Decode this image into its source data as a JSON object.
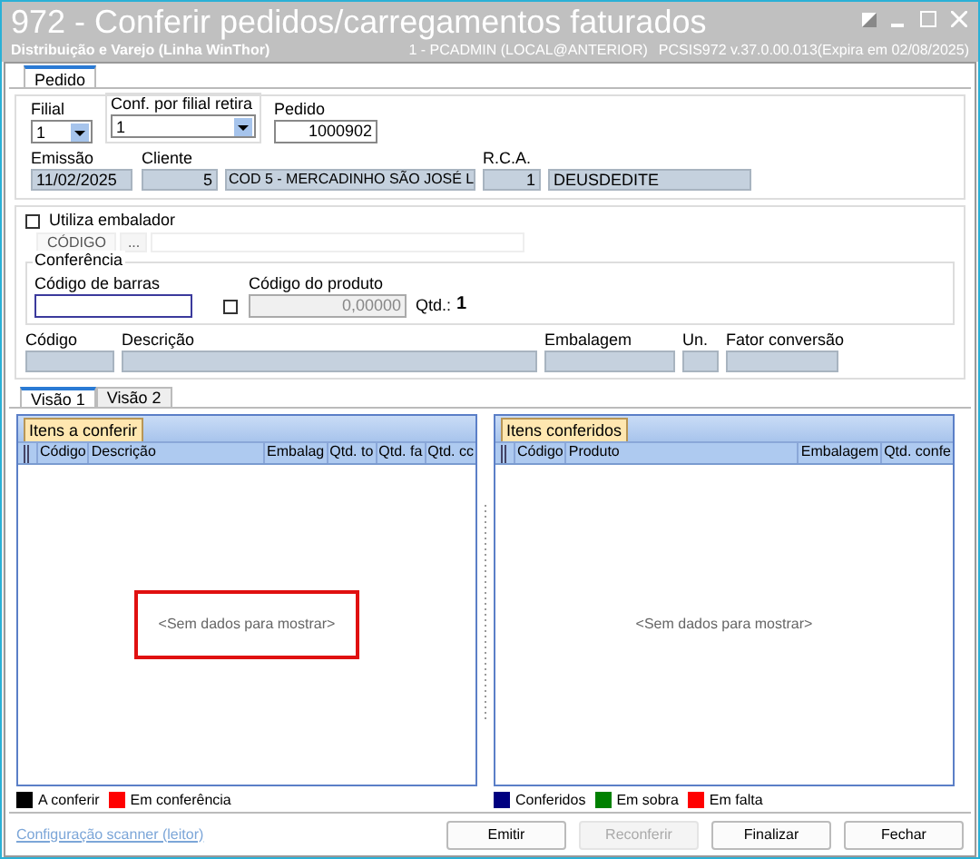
{
  "window": {
    "title": "972 - Conferir pedidos/carregamentos faturados",
    "subtitle": "Distribuição e Varejo (Linha WinThor)",
    "user_info": "1 - PCADMIN (LOCAL@ANTERIOR)",
    "version_info": "PCSIS972  v.37.0.00.013(Expira em 02/08/2025)"
  },
  "tabs": [
    {
      "label": "Pedido",
      "selected": true
    }
  ],
  "header": {
    "filial": {
      "label": "Filial",
      "value": "1"
    },
    "conf_filial": {
      "label": "Conf. por filial retira",
      "value": "1"
    },
    "pedido": {
      "label": "Pedido",
      "value": "1000902"
    },
    "emissao": {
      "label": "Emissão",
      "value": "11/02/2025"
    },
    "cliente": {
      "label": "Cliente",
      "code": "5",
      "name": "COD 5 - MERCADINHO SÃO JOSÉ L"
    },
    "rca": {
      "label": "R.C.A.",
      "code": "1",
      "name": "DEUSDEDITE"
    }
  },
  "embalador": {
    "label": "Utiliza embalador",
    "checked": false,
    "code_label": "CÓDIGO",
    "browse": "..."
  },
  "conferencia": {
    "title": "Conferência",
    "barcode_label": "Código de barras",
    "product_label": "Código do produto",
    "product_checked": false,
    "product_value": "0,00000",
    "qty_label": "Qtd.:",
    "qty_value": "1"
  },
  "product_fields": [
    {
      "label": "Código"
    },
    {
      "label": "Descrição"
    },
    {
      "label": "Embalagem"
    },
    {
      "label": "Un."
    },
    {
      "label": "Fator conversão"
    }
  ],
  "view_tabs": [
    {
      "label": "Visão 1",
      "selected": true
    },
    {
      "label": "Visão 2",
      "selected": false
    }
  ],
  "grids": [
    {
      "title": "Itens a conferir",
      "columns": [
        "Código",
        "Descrição",
        "Embalag",
        "Qtd. to",
        "Qtd. fa",
        "Qtd. cc"
      ],
      "empty_text": "<Sem dados para mostrar>",
      "highlighted": true,
      "legend": [
        {
          "label": "A conferir",
          "color": "#000000"
        },
        {
          "label": "Em conferência",
          "color": "#ff0000"
        }
      ]
    },
    {
      "title": "Itens conferidos",
      "columns": [
        "Código",
        "Produto",
        "Embalagem",
        "Qtd. confe"
      ],
      "empty_text": "<Sem dados para mostrar>",
      "highlighted": false,
      "legend": [
        {
          "label": "Conferidos",
          "color": "#000080"
        },
        {
          "label": "Em sobra",
          "color": "#008000"
        },
        {
          "label": "Em falta",
          "color": "#ff0000"
        }
      ]
    }
  ],
  "footer": {
    "link": "Configuração scanner (leitor)",
    "buttons": [
      {
        "label": "Emitir",
        "disabled": false
      },
      {
        "label": "Reconferir",
        "disabled": true
      },
      {
        "label": "Finalizar",
        "disabled": false
      },
      {
        "label": "Fechar",
        "disabled": false
      }
    ]
  }
}
